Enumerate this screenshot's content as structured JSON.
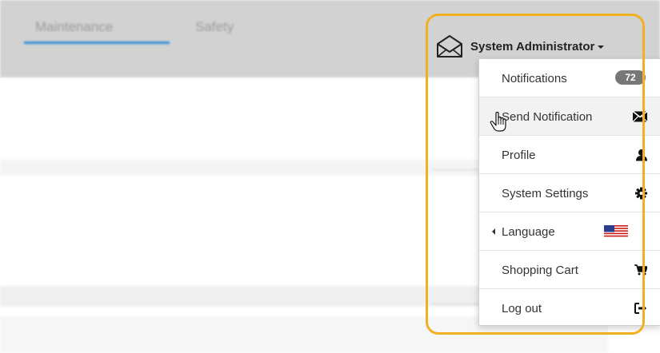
{
  "tabs": [
    "Maintenance",
    "Safety"
  ],
  "user": {
    "name": "System Administrator"
  },
  "menu": {
    "items": [
      {
        "label": "Notifications",
        "icon": "badge",
        "badge": "72"
      },
      {
        "label": "Send Notification",
        "icon": "envelope-icon"
      },
      {
        "label": "Profile",
        "icon": "user-icon"
      },
      {
        "label": "System Settings",
        "icon": "gear-icon"
      },
      {
        "label": "Language",
        "icon": "us-flag-icon"
      },
      {
        "label": "Shopping Cart",
        "icon": "cart-icon"
      },
      {
        "label": "Log out",
        "icon": "logout-icon"
      }
    ]
  },
  "colors": {
    "highlight": "#f0b020",
    "tab_underline": "#2d8cd8",
    "badge": "#777777"
  }
}
